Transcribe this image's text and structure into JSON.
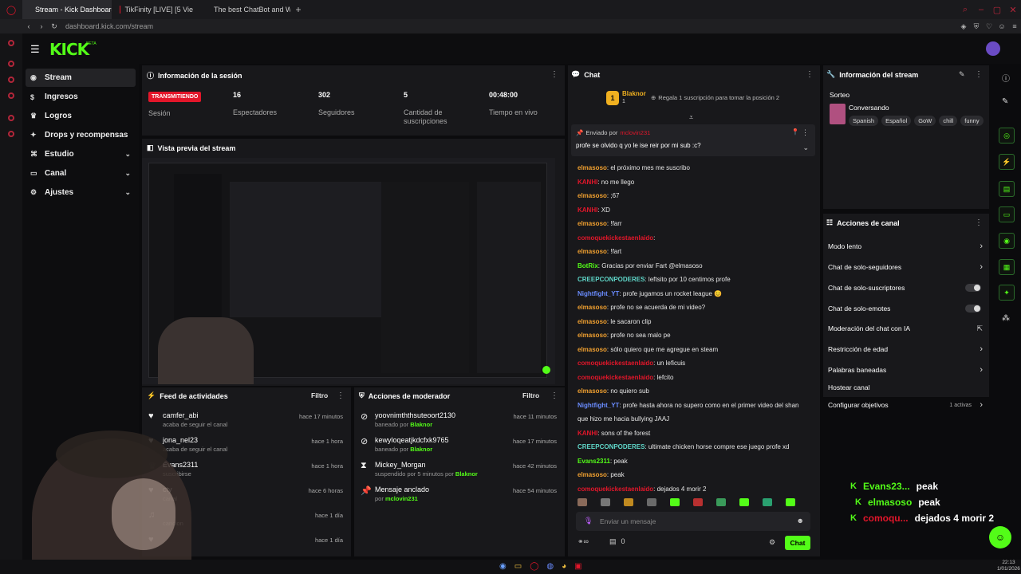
{
  "browser": {
    "tabs": [
      {
        "label": "Stream - Kick Dashboard",
        "color": "#53fc18"
      },
      {
        "label": "TikFinity [LIVE] [5 Vie",
        "color": "#e3162a"
      },
      {
        "label": "The best ChatBot and Wid",
        "color": "#9a9a9a"
      }
    ],
    "url": "dashboard.kick.com/stream"
  },
  "header": {
    "logo": "KICK",
    "logo_sup": "BETA"
  },
  "nav": [
    {
      "label": "Stream",
      "icon": "broadcast-icon",
      "active": true,
      "chev": false
    },
    {
      "label": "Ingresos",
      "icon": "dollar-icon",
      "active": false,
      "chev": false
    },
    {
      "label": "Logros",
      "icon": "trophy-icon",
      "active": false,
      "chev": false
    },
    {
      "label": "Drops y recompensas",
      "icon": "gift-icon",
      "active": false,
      "chev": false
    },
    {
      "label": "Estudio",
      "icon": "studio-icon",
      "active": false,
      "chev": true
    },
    {
      "label": "Canal",
      "icon": "channel-icon",
      "active": false,
      "chev": true
    },
    {
      "label": "Ajustes",
      "icon": "gear-icon",
      "active": false,
      "chev": true
    }
  ],
  "session": {
    "title": "Información de la sesión",
    "live_badge": "TRANSMITIENDO",
    "live_label": "Sesión",
    "stats": [
      {
        "value": "16",
        "label": "Espectadores"
      },
      {
        "value": "302",
        "label": "Seguidores"
      },
      {
        "value": "5",
        "label": "Cantidad de suscripciones"
      },
      {
        "value": "00:48:00",
        "label": "Tiempo en vivo"
      }
    ]
  },
  "preview": {
    "title": "Vista previa del stream"
  },
  "feed": {
    "title": "Feed de actividades",
    "filter": "Filtro",
    "items": [
      {
        "name": "camfer_abi",
        "sub": "acaba de seguir el canal",
        "time": "hace 17 minutos"
      },
      {
        "name": "jona_nel23",
        "sub": "acaba de seguir el canal",
        "time": "hace 1 hora"
      },
      {
        "name": "Evans2311",
        "sub": "suscribirse",
        "time": "hace 1 hora"
      },
      {
        "name": "cty",
        "sub": "canal",
        "time": "hace 6 horas"
      },
      {
        "name": "",
        "sub": "cancion",
        "time": "hace 1 día"
      },
      {
        "name": "",
        "sub": "",
        "time": "hace 1 día"
      }
    ]
  },
  "mod": {
    "title": "Acciones de moderador",
    "filter": "Filtro",
    "items": [
      {
        "name": "yoovnimththsuteoort2130",
        "pre": "baneado por",
        "by": "Blaknor",
        "time": "hace 11 minutos",
        "icon": "ban-icon"
      },
      {
        "name": "kewyloqeatjkdcfxk9765",
        "pre": "baneado por",
        "by": "Blaknor",
        "time": "hace 17 minutos",
        "icon": "ban-icon"
      },
      {
        "name": "Mickey_Morgan",
        "pre": "suspendido por 5 minutos por",
        "by": "Blaknor",
        "time": "hace 42 minutos",
        "icon": "hourglass-icon"
      },
      {
        "name": "Mensaje anclado",
        "pre": "por",
        "by": "mclovin231",
        "time": "hace 54 minutos",
        "icon": "pin-icon"
      }
    ]
  },
  "chat": {
    "title": "Chat",
    "top_user": "Blaknor",
    "top_count": "1",
    "top_rank": "1",
    "gift_text": "Regala 1 suscripción para tomar la posición 2",
    "pinned_by_label": "Enviado por",
    "pinned_by": "mclovin231",
    "pinned_msg": "profe se olvido q yo le ise reir por mi sub :c?",
    "messages": [
      {
        "user": "elmasoso",
        "color": "#f0a030",
        "text": "el próximo mes me suscribo"
      },
      {
        "user": "KANHI",
        "color": "#e3162a",
        "text": "no me llego"
      },
      {
        "user": "elmasoso",
        "color": "#f0a030",
        "text": ";67"
      },
      {
        "user": "KANHI",
        "color": "#e3162a",
        "text": "XD"
      },
      {
        "user": "elmasoso",
        "color": "#f0a030",
        "text": "!farr"
      },
      {
        "user": "comoquekickestaenlaido",
        "color": "#e3162a",
        "text": ""
      },
      {
        "user": "elmasoso",
        "color": "#f0a030",
        "text": "!fart"
      },
      {
        "user": "BotRix",
        "color": "#53fc18",
        "text": "Gracias por enviar Fart @elmasoso"
      },
      {
        "user": "CREEPCONPODERES",
        "color": "#5fd6c8",
        "text": "leftsito por 10 centimos profe"
      },
      {
        "user": "Nightfight_YT",
        "color": "#6a8cff",
        "text": "profe jugamos un rocket league 😊"
      },
      {
        "user": "elmasoso",
        "color": "#f0a030",
        "text": "profe no se acuerda de mi video?"
      },
      {
        "user": "elmasoso",
        "color": "#f0a030",
        "text": "le sacaron clip"
      },
      {
        "user": "elmasoso",
        "color": "#f0a030",
        "text": "profe no sea malo pe"
      },
      {
        "user": "elmasoso",
        "color": "#f0a030",
        "text": "sólo quiero que me agregue en steam"
      },
      {
        "user": "comoquekickestaenlaido",
        "color": "#e3162a",
        "text": "un leficuis"
      },
      {
        "user": "comoquekickestaenlaido",
        "color": "#e3162a",
        "text": "lefcito"
      },
      {
        "user": "elmasoso",
        "color": "#f0a030",
        "text": "no quiero sub"
      },
      {
        "user": "Nightfight_YT",
        "color": "#6a8cff",
        "text": "profe hasta ahora no supero como en el primer video del shan"
      },
      {
        "user": "",
        "color": "#e6e6e6",
        "text": "que hizo me hacia bullying JAAJ"
      },
      {
        "user": "KANHI",
        "color": "#e3162a",
        "text": "sons of the forest"
      },
      {
        "user": "CREEPCONPODERES",
        "color": "#5fd6c8",
        "text": "ultimate chicken horse compre ese juego profe xd"
      },
      {
        "user": "Evans2311",
        "color": "#53fc18",
        "text": "peak"
      },
      {
        "user": "elmasoso",
        "color": "#f0a030",
        "text": "peak"
      },
      {
        "user": "comoquekickestaenlaido",
        "color": "#e3162a",
        "text": "dejados 4 morir 2"
      }
    ],
    "input_placeholder": "Enviar un mensaje",
    "viewers_count": "0",
    "send_label": "Chat"
  },
  "stream_info": {
    "title": "Información del stream",
    "section": "Sorteo",
    "category": "Conversando",
    "tags": [
      "Spanish",
      "Español",
      "GoW",
      "chill",
      "funny"
    ]
  },
  "channel_actions": {
    "title": "Acciones de canal",
    "items": [
      {
        "label": "Modo lento",
        "type": "arrow"
      },
      {
        "label": "Chat de solo-seguidores",
        "type": "arrow"
      },
      {
        "label": "Chat de solo-suscriptores",
        "type": "toggle"
      },
      {
        "label": "Chat de solo-emotes",
        "type": "toggle"
      },
      {
        "label": "Moderación del chat con IA",
        "type": "external"
      },
      {
        "label": "Restricción de edad",
        "type": "arrow"
      },
      {
        "label": "Palabras baneadas",
        "type": "arrow"
      },
      {
        "label": "Hostear canal",
        "type": "none"
      },
      {
        "label": "Configurar objetivos",
        "type": "arrow"
      }
    ],
    "goals_status": "1 activas"
  },
  "overlay_chat": [
    {
      "user": "Evans23...",
      "color": "#53fc18",
      "text": "peak"
    },
    {
      "user": "elmasoso",
      "color": "#53fc18",
      "text": "peak"
    },
    {
      "user": "comoqu...",
      "color": "#e3162a",
      "text": "dejados 4 morir 2"
    }
  ],
  "taskbar": {
    "time": "22:13",
    "date": "1/01/2026"
  }
}
